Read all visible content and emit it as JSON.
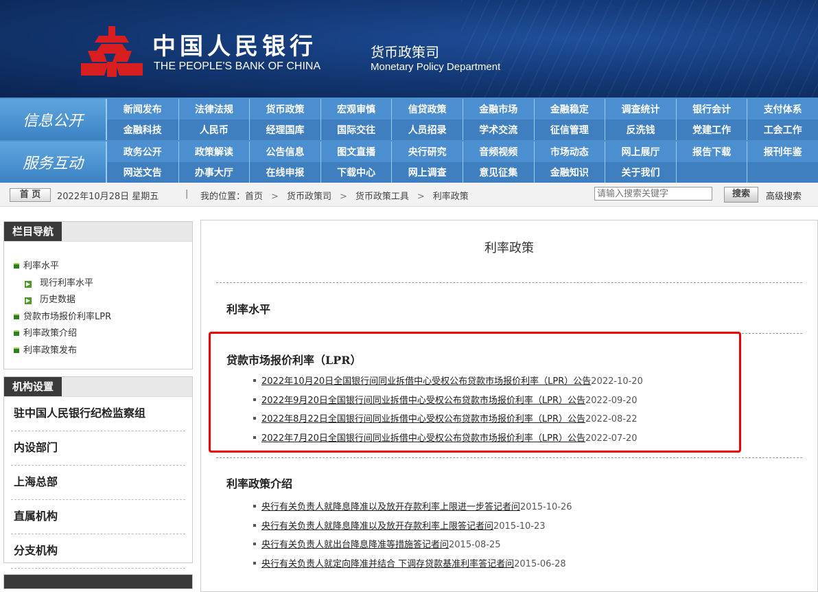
{
  "header": {
    "bank_name_cn": "中国人民银行",
    "bank_name_en": "THE PEOPLE'S BANK OF CHINA",
    "dept_cn": "货币政策司",
    "dept_en": "Monetary Policy Department"
  },
  "nav": {
    "info": {
      "category": "信息公开",
      "row1": [
        "新闻发布",
        "法律法规",
        "货币政策",
        "宏观审慎",
        "信贷政策",
        "金融市场",
        "金融稳定",
        "调查统计",
        "银行会计",
        "支付体系"
      ],
      "row2": [
        "金融科技",
        "人民币",
        "经理国库",
        "国际交往",
        "人员招录",
        "学术交流",
        "征信管理",
        "反洗钱",
        "党建工作",
        "工会工作"
      ]
    },
    "service": {
      "category": "服务互动",
      "row1": [
        "政务公开",
        "政策解读",
        "公告信息",
        "图文直播",
        "央行研究",
        "音频视频",
        "市场动态",
        "网上展厅",
        "报告下载",
        "报刊年鉴"
      ],
      "row2": [
        "网送文告",
        "办事大厅",
        "在线申报",
        "下载中心",
        "网上调查",
        "意见征集",
        "金融知识",
        "关于我们",
        "",
        ""
      ]
    }
  },
  "toolbar": {
    "home_label": "首 页",
    "date": "2022年10月28日 星期五",
    "separator": "|",
    "location_label": "我的位置：",
    "crumbs": [
      "首页",
      "货币政策司",
      "货币政策工具",
      "利率政策"
    ],
    "search_placeholder": "请输入搜索关键字",
    "search_label": "搜索",
    "advanced_search": "高级搜索"
  },
  "sidebar": {
    "nav_title": "栏目导航",
    "nav_items": [
      {
        "label": "利率水平",
        "sub": false
      },
      {
        "label": "现行利率水平",
        "sub": true
      },
      {
        "label": "历史数据",
        "sub": true
      },
      {
        "label": "贷款市场报价利率LPR",
        "sub": false
      },
      {
        "label": "利率政策介绍",
        "sub": false
      },
      {
        "label": "利率政策发布",
        "sub": false
      }
    ],
    "org_title": "机构设置",
    "orgs": [
      "驻中国人民银行纪检监察组",
      "内设部门",
      "上海总部",
      "直属机构",
      "分支机构"
    ]
  },
  "main": {
    "title": "利率政策",
    "sections": [
      {
        "title": "利率水平",
        "items": []
      },
      {
        "title": "贷款市场报价利率（LPR）",
        "items": [
          {
            "text": "2022年10月20日全国银行间同业拆借中心受权公布贷款市场报价利率（LPR）公告",
            "date": "2022-10-20"
          },
          {
            "text": "2022年9月20日全国银行间同业拆借中心受权公布贷款市场报价利率（LPR）公告",
            "date": "2022-09-20"
          },
          {
            "text": "2022年8月22日全国银行间同业拆借中心受权公布贷款市场报价利率（LPR）公告",
            "date": "2022-08-22"
          },
          {
            "text": "2022年7月20日全国银行间同业拆借中心受权公布贷款市场报价利率（LPR）公告",
            "date": "2022-07-20"
          }
        ]
      },
      {
        "title": "利率政策介绍",
        "items": [
          {
            "text": "央行有关负责人就降息降准以及放开存款利率上限进一步答记者问",
            "date": "2015-10-26"
          },
          {
            "text": "央行有关负责人就降息降准以及放开存款利率上限答记者问",
            "date": "2015-10-23"
          },
          {
            "text": "央行有关负责人就出台降息降准等措施答记者问",
            "date": "2015-08-25"
          },
          {
            "text": "央行有关负责人就定向降准并结合 下调存贷款基准利率答记者问",
            "date": "2015-06-28"
          }
        ]
      }
    ]
  },
  "colors": {
    "banner": "#143a78",
    "nav": "#4d90cd",
    "highlight": "#e00000"
  }
}
